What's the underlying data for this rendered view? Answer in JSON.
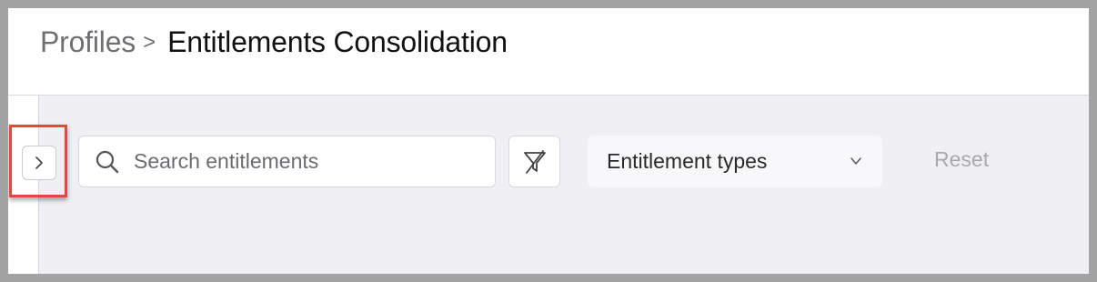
{
  "breadcrumb": {
    "parent": "Profiles",
    "separator": ">",
    "current": "Entitlements Consolidation"
  },
  "sidebar": {
    "expand_glyph": ">",
    "expand_icon": "chevron-right-icon"
  },
  "search": {
    "placeholder": "Search entitlements",
    "value": "",
    "icon": "search-icon"
  },
  "filter": {
    "icon": "clear-filter-icon"
  },
  "entitlement_types": {
    "label": "Entitlement types",
    "icon": "chevron-down-icon"
  },
  "reset": {
    "label": "Reset"
  },
  "colors": {
    "highlight": "#e8453c",
    "content_background": "#efeff4",
    "breadcrumb_parent": "#6f7073",
    "reset_disabled": "#a8a9ad"
  }
}
